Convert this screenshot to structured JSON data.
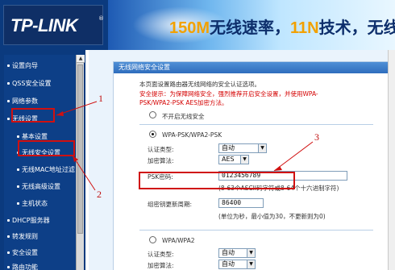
{
  "header": {
    "logo": "TP-LINK",
    "slogan_part1": "150M",
    "slogan_part2": "无线速率，",
    "slogan_part3": "11N",
    "slogan_part4": "技术，无线生活"
  },
  "sidebar": {
    "items": [
      {
        "label": "设置向导"
      },
      {
        "label": "QSS安全设置"
      },
      {
        "label": "网络参数"
      },
      {
        "label": "无线设置"
      },
      {
        "label": "基本设置"
      },
      {
        "label": "无线安全设置"
      },
      {
        "label": "无线MAC地址过滤"
      },
      {
        "label": "无线高级设置"
      },
      {
        "label": "主机状态"
      },
      {
        "label": "DHCP服务器"
      },
      {
        "label": "转发规则"
      },
      {
        "label": "安全设置"
      },
      {
        "label": "路由功能"
      }
    ]
  },
  "main": {
    "title": "无线网络安全设置",
    "intro": "本页面设置路由器无线网络的安全认证选项。",
    "warning_line1": "安全提示：为保障网络安全，强烈推荐开启安全设置，并使用WPA-",
    "warning_line2": "PSK/WPA2-PSK AES加密方法。",
    "option_none": "不开启无线安全",
    "option_wpa_psk": "WPA-PSK/WPA2-PSK",
    "auth_label": "认证类型:",
    "auth_value": "自动",
    "encrypt_label": "加密算法:",
    "encrypt_value": "AES",
    "psk_label": "PSK密码:",
    "psk_value": "0123456789",
    "psk_hint": "(8-63个ASCII码字符或8-64个十六进制字符)",
    "renew_label": "组密钥更新周期:",
    "renew_value": "86400",
    "renew_hint": "(单位为秒，最小值为30，不更新则为0)",
    "option_wpa": "WPA/WPA2",
    "auth_label2": "认证类型:",
    "auth_value2": "自动",
    "encrypt_label2": "加密算法:",
    "encrypt_value2": "自动"
  },
  "annotations": {
    "n1": "1",
    "n2": "2",
    "n3": "3",
    "color": "#d01010"
  },
  "colors": {
    "nav_bg": "#0b3a7e",
    "panel_title": "#2f6dbd",
    "warning": "#d40000",
    "slogan_accent": "#f2a100"
  }
}
